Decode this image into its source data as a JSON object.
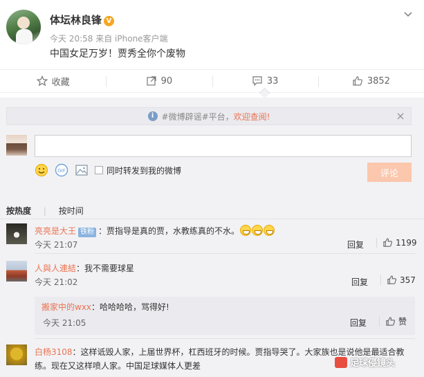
{
  "post": {
    "author": "体坛林良锋",
    "verified_badge": "V",
    "time": "今天 20:58",
    "source": "来自 iPhone客户端",
    "text": "中国女足万岁！贾秀全你个废物"
  },
  "actions": {
    "favorite": "收藏",
    "repost": "90",
    "comment": "33",
    "like": "3852"
  },
  "notice": {
    "prefix": "#微博辟谣#平台，",
    "highlight": "欢迎查阅!"
  },
  "composer": {
    "checkbox_label": "同时转发到我的微博",
    "submit": "评论",
    "icons": [
      "emoji-icon",
      "gif-icon",
      "image-icon"
    ]
  },
  "sort": {
    "hot": "按热度",
    "time": "按时间"
  },
  "comments": [
    {
      "user": "亮亮是大王",
      "badge": "铁粉",
      "text": "：贾指导是真的贾，水教练真的不水。",
      "time": "今天 21:07",
      "reply": "回复",
      "likes": "1199"
    },
    {
      "user": "人與人連結",
      "text": "：我不需要球星",
      "time": "今天 21:02",
      "reply": "回复",
      "likes": "357"
    },
    {
      "user": "搬家中的wxx",
      "text": "：哈哈哈哈，骂得好!",
      "time": "今天 21:05",
      "reply": "回复",
      "likes": "赞"
    },
    {
      "user": "白杨3108",
      "text": "：这样诋毁人家，上届世界杯，杠西班牙的时候。贾指导哭了。大家族也是说他是最适合教练。现在又这样喷人家。中国足球媒体人更差"
    }
  ],
  "watermark": "足球侵镜头",
  "colors": {
    "accent": "#eb7350",
    "panel": "#f2f2f5",
    "submit_disabled": "#fbc7ad",
    "verified": "#f5a623"
  }
}
